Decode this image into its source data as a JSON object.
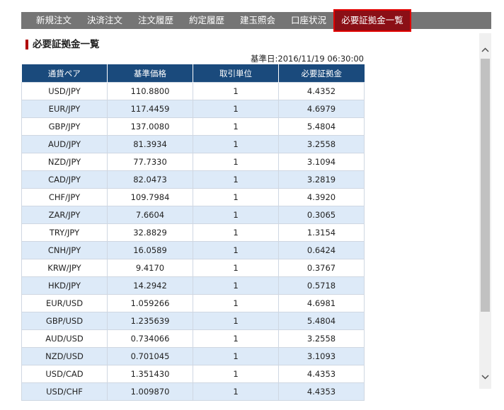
{
  "tabs": [
    {
      "label": "新規注文",
      "active": false
    },
    {
      "label": "決済注文",
      "active": false
    },
    {
      "label": "注文履歴",
      "active": false
    },
    {
      "label": "約定履歴",
      "active": false
    },
    {
      "label": "建玉照会",
      "active": false
    },
    {
      "label": "口座状況",
      "active": false
    },
    {
      "label": "必要証拠金一覧",
      "active": true
    }
  ],
  "page": {
    "title": "必要証拠金一覧",
    "base_date_label": "基準日:",
    "base_date_value": "2016/11/19 06:30:00"
  },
  "table": {
    "headers": [
      "通貨ペア",
      "基準価格",
      "取引単位",
      "必要証拠金"
    ],
    "rows": [
      [
        "USD/JPY",
        "110.8800",
        "1",
        "4.4352"
      ],
      [
        "EUR/JPY",
        "117.4459",
        "1",
        "4.6979"
      ],
      [
        "GBP/JPY",
        "137.0080",
        "1",
        "5.4804"
      ],
      [
        "AUD/JPY",
        "81.3934",
        "1",
        "3.2558"
      ],
      [
        "NZD/JPY",
        "77.7330",
        "1",
        "3.1094"
      ],
      [
        "CAD/JPY",
        "82.0473",
        "1",
        "3.2819"
      ],
      [
        "CHF/JPY",
        "109.7984",
        "1",
        "4.3920"
      ],
      [
        "ZAR/JPY",
        "7.6604",
        "1",
        "0.3065"
      ],
      [
        "TRY/JPY",
        "32.8829",
        "1",
        "1.3154"
      ],
      [
        "CNH/JPY",
        "16.0589",
        "1",
        "0.6424"
      ],
      [
        "KRW/JPY",
        "9.4170",
        "1",
        "0.3767"
      ],
      [
        "HKD/JPY",
        "14.2942",
        "1",
        "0.5718"
      ],
      [
        "EUR/USD",
        "1.059266",
        "1",
        "4.6981"
      ],
      [
        "GBP/USD",
        "1.235639",
        "1",
        "5.4804"
      ],
      [
        "AUD/USD",
        "0.734066",
        "1",
        "3.2558"
      ],
      [
        "NZD/USD",
        "0.701045",
        "1",
        "3.1093"
      ],
      [
        "USD/CAD",
        "1.351430",
        "1",
        "4.4353"
      ],
      [
        "USD/CHF",
        "1.009870",
        "1",
        "4.4353"
      ]
    ]
  },
  "scrollbar": {
    "up_icon": "chevron-up-icon",
    "down_icon": "chevron-down-icon"
  },
  "colors": {
    "tab_bar": "#757575",
    "active_tab": "#8b0f16",
    "active_tab_border": "#e00000",
    "table_header": "#1a4a7c",
    "row_alt": "#ddeaf8",
    "title_bar": "#b00000"
  }
}
